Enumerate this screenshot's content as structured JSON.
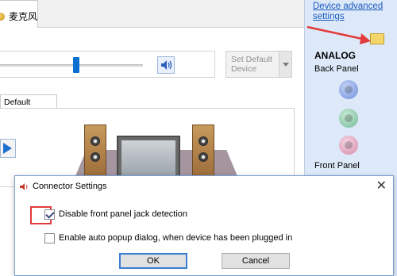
{
  "tabs": {
    "active_label": "麦克风"
  },
  "main": {
    "volume_percent": 52,
    "set_default_label": "Set Default Device",
    "subtab_label": "Default Format"
  },
  "side_panel": {
    "link": "Device advanced settings",
    "section": "ANALOG",
    "back_panel": "Back Panel",
    "front_panel": "Front Panel",
    "jack_colors": [
      "#7d9ce0",
      "#8cc4a8",
      "#e0a4bd"
    ]
  },
  "dialog": {
    "title": "Connector Settings",
    "options": [
      {
        "label": "Disable front panel jack detection",
        "checked": true
      },
      {
        "label": "Enable auto popup dialog, when device has been plugged in",
        "checked": false
      }
    ],
    "ok_label": "OK",
    "cancel_label": "Cancel",
    "close_glyph": "✕"
  },
  "colors": {
    "annotation_red": "#e23b3b",
    "link_blue": "#1a5bbf",
    "side_bg": "#dde8f8"
  }
}
